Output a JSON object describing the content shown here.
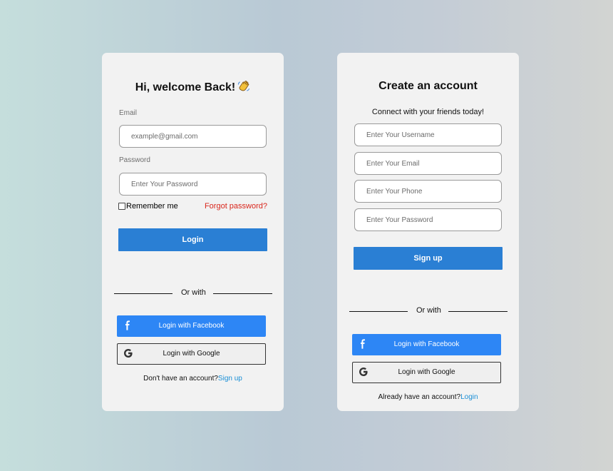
{
  "login_card": {
    "title": "Hi, welcome Back!",
    "email_label": "Email",
    "email_placeholder": "example@gmail.com",
    "password_label": "Password",
    "password_placeholder": "Enter Your Password",
    "remember_label": "Remember me",
    "forgot_label": "Forgot password?",
    "submit_label": "Login",
    "divider_text": "Or with",
    "facebook_label": "Login with Facebook",
    "google_label": "Login with Google",
    "footer_text": "Don't have an account?",
    "footer_link": "Sign up"
  },
  "signup_card": {
    "title": "Create an account",
    "subtitle": "Connect with your friends today!",
    "username_placeholder": "Enter Your Username",
    "email_placeholder": "Enter Your Email",
    "phone_placeholder": "Enter Your Phone",
    "password_placeholder": "Enter Your Password",
    "submit_label": "Sign up",
    "divider_text": "Or with",
    "facebook_label": "Login with Facebook",
    "google_label": "Login with Google",
    "footer_text": "Already have an account?",
    "footer_link": "Login"
  },
  "icons": {
    "wave": "waving-hand-icon",
    "facebook": "facebook-icon",
    "google": "google-icon"
  },
  "colors": {
    "primary_button": "#2a7fd4",
    "facebook_button": "#2d86f5",
    "forgot_link": "#d9261c",
    "footer_link": "#1a8fd6",
    "card": "#f2f2f2"
  }
}
